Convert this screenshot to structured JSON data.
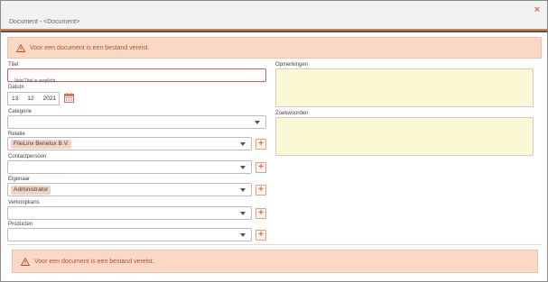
{
  "window": {
    "title": "Document - <Document>",
    "close_icon": "×"
  },
  "alerts": {
    "top": "Voor een document is een bestand vereist.",
    "bottom": "Voor een document is een bestand vereist."
  },
  "form": {
    "titel": {
      "label": "Titel",
      "value": "",
      "error": "Veld Titel is verplicht."
    },
    "datum": {
      "label": "Datum",
      "day": "13",
      "month": "12",
      "year": "2021"
    },
    "categorie": {
      "label": "Categorie",
      "value": ""
    },
    "relatie": {
      "label": "Relatie",
      "value": "FileLinx Benelux B.V."
    },
    "contactpersoon": {
      "label": "Contactpersoon",
      "value": ""
    },
    "eigenaar": {
      "label": "Eigenaar",
      "value": "Administrator"
    },
    "verkoopkans": {
      "label": "Verkoopkans",
      "value": ""
    },
    "producten": {
      "label": "Producten",
      "value": ""
    },
    "opmerkingen": {
      "label": "Opmerkingen",
      "value": ""
    },
    "zoekwoorden": {
      "label": "Zoekwoorden",
      "value": ""
    }
  },
  "icons": {
    "warning": "warning-icon",
    "calendar": "calendar-icon",
    "add": "+"
  },
  "colors": {
    "accent": "#e07a3a",
    "alert_bg": "#f9d9c6",
    "alert_text": "#b2532a",
    "error": "#e05555",
    "textarea_bg": "#fbf8d4"
  }
}
